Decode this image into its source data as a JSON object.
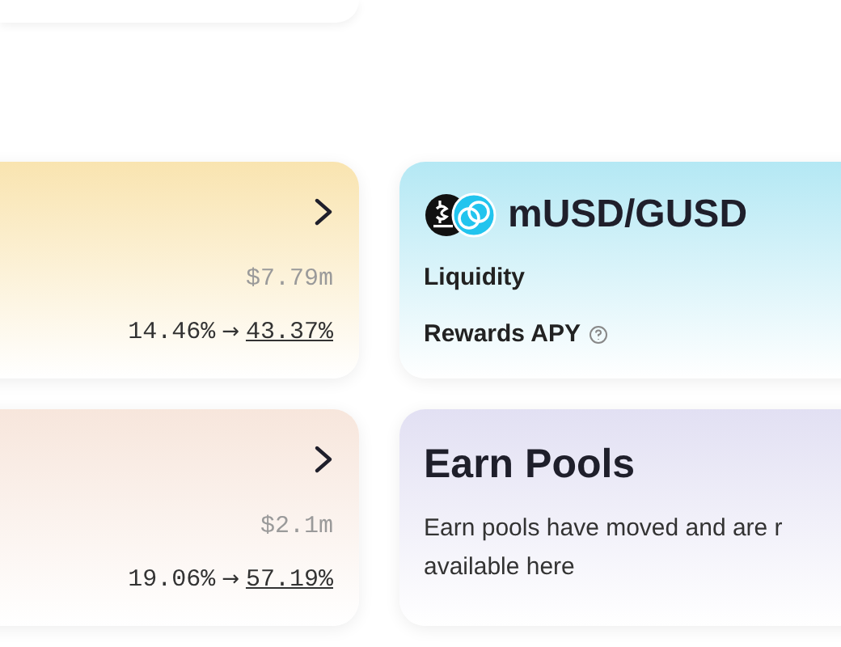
{
  "left_cards": [
    {
      "tvl": "$7.79m",
      "apy_from": "14.46%",
      "arrow": "→",
      "apy_to": "43.37%",
      "color": "#f9e4b0"
    },
    {
      "tvl": "$2.1m",
      "apy_from": "19.06%",
      "arrow": "→",
      "apy_to": "57.19%",
      "color": "#f7e6dc"
    }
  ],
  "right_cards": [
    {
      "kind": "pool",
      "title": "mUSD/GUSD",
      "rows": [
        {
          "label": "Liquidity",
          "help": false
        },
        {
          "label": "Rewards APY",
          "help": true
        }
      ],
      "color": "#b4e8f4"
    },
    {
      "kind": "info",
      "title": "Earn Pools",
      "shown_text": "Earn pools have moved and are r",
      "shown_text_2": "available here",
      "color": "#e2e0f3"
    }
  ]
}
